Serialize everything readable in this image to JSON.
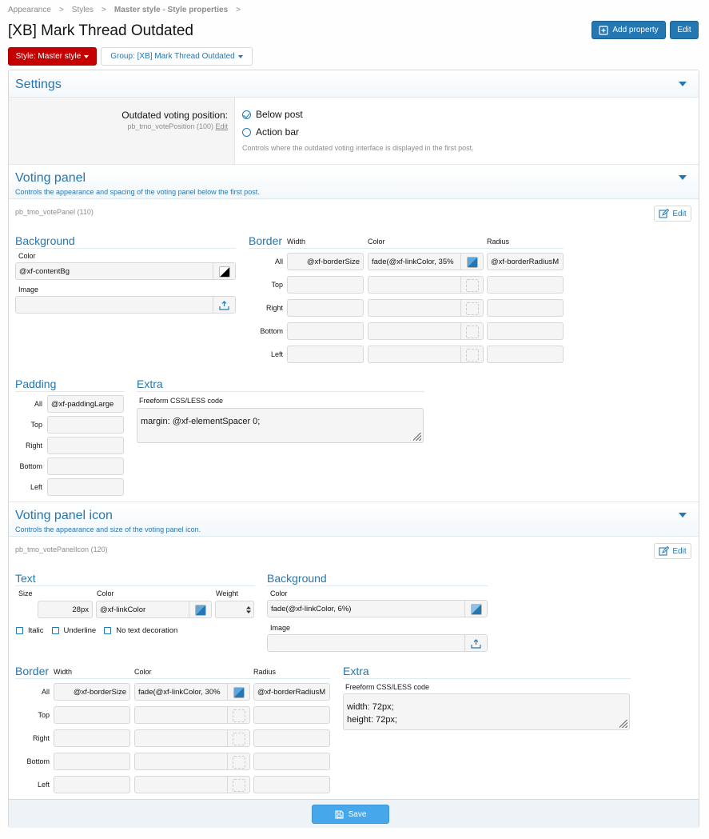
{
  "breadcrumb": {
    "items": [
      "Appearance",
      "Styles",
      "Master style - Style properties"
    ]
  },
  "page": {
    "title": "[XB] Mark Thread Outdated"
  },
  "header_buttons": {
    "add_property": "Add property",
    "edit": "Edit"
  },
  "filters": {
    "style": "Style: Master style",
    "group": "Group: [XB] Mark Thread Outdated"
  },
  "settings": {
    "title": "Settings",
    "position_label": "Outdated voting position:",
    "position_key": "pb_tmo_votePosition (100)",
    "position_edit": "Edit",
    "options": [
      {
        "label": "Below post",
        "selected": true
      },
      {
        "label": "Action bar",
        "selected": false
      }
    ],
    "hint": "Controls where the outdated voting interface is displayed in the first post."
  },
  "voting_panel": {
    "title": "Voting panel",
    "desc": "Controls the appearance and spacing of the voting panel below the first post.",
    "key": "pb_tmo_votePanel (110)",
    "edit": "Edit",
    "background": {
      "title": "Background",
      "color_label": "Color",
      "color_value": "@xf-contentBg",
      "image_label": "Image",
      "image_value": ""
    },
    "border": {
      "title": "Border",
      "col_width": "Width",
      "col_color": "Color",
      "col_radius": "Radius",
      "rows": [
        {
          "label": "All",
          "width": "@xf-borderSize",
          "color": "fade(@xf-linkColor, 35%",
          "radius": "@xf-borderRadiusM"
        },
        {
          "label": "Top",
          "width": "",
          "color": "",
          "radius": ""
        },
        {
          "label": "Right",
          "width": "",
          "color": "",
          "radius": ""
        },
        {
          "label": "Bottom",
          "width": "",
          "color": "",
          "radius": ""
        },
        {
          "label": "Left",
          "width": "",
          "color": "",
          "radius": ""
        }
      ]
    },
    "padding": {
      "title": "Padding",
      "rows": [
        {
          "label": "All",
          "value": "@xf-paddingLarge"
        },
        {
          "label": "Top",
          "value": ""
        },
        {
          "label": "Right",
          "value": ""
        },
        {
          "label": "Bottom",
          "value": ""
        },
        {
          "label": "Left",
          "value": ""
        }
      ]
    },
    "extra": {
      "title": "Extra",
      "label": "Freeform CSS/LESS code",
      "value": "margin: @xf-elementSpacer 0;"
    }
  },
  "voting_icon": {
    "title": "Voting panel icon",
    "desc": "Controls the appearance and size of the voting panel icon.",
    "key": "pb_tmo_votePanelIcon (120)",
    "edit": "Edit",
    "text": {
      "title": "Text",
      "size_label": "Size",
      "size_value": "28px",
      "color_label": "Color",
      "color_value": "@xf-linkColor",
      "weight_label": "Weight",
      "italic": "Italic",
      "underline": "Underline",
      "no_decoration": "No text decoration"
    },
    "background": {
      "title": "Background",
      "color_label": "Color",
      "color_value": "fade(@xf-linkColor, 6%)",
      "image_label": "Image",
      "image_value": ""
    },
    "border": {
      "title": "Border",
      "col_width": "Width",
      "col_color": "Color",
      "col_radius": "Radius",
      "rows": [
        {
          "label": "All",
          "width": "@xf-borderSize",
          "color": "fade(@xf-linkColor, 30%",
          "radius": "@xf-borderRadiusM"
        },
        {
          "label": "Top",
          "width": "",
          "color": "",
          "radius": ""
        },
        {
          "label": "Right",
          "width": "",
          "color": "",
          "radius": ""
        },
        {
          "label": "Bottom",
          "width": "",
          "color": "",
          "radius": ""
        },
        {
          "label": "Left",
          "width": "",
          "color": "",
          "radius": ""
        }
      ]
    },
    "extra": {
      "title": "Extra",
      "label": "Freeform CSS/LESS code",
      "line1": "width: 72px;",
      "line2": "height: 72px;"
    }
  },
  "footer": {
    "save": "Save"
  },
  "colors": {
    "accent": "#2577b1",
    "danger": "#c40000",
    "save": "#47a7eb"
  }
}
